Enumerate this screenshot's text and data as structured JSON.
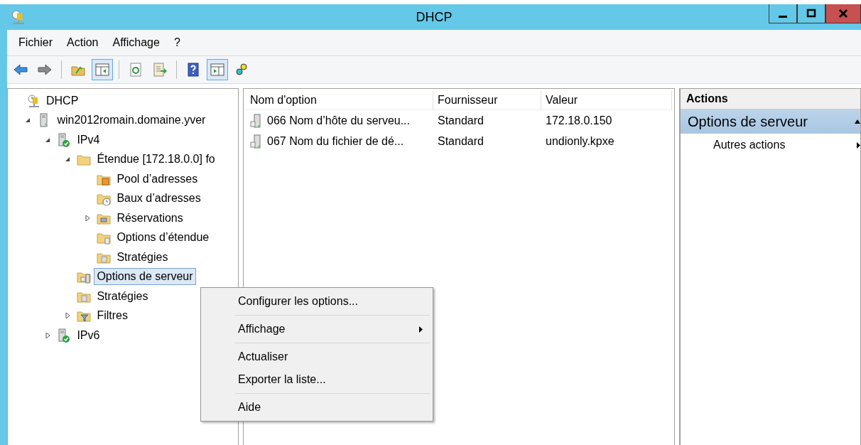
{
  "window": {
    "title": "DHCP"
  },
  "menu_bar": [
    "Fichier",
    "Action",
    "Affichage",
    "?"
  ],
  "toolbar": [
    {
      "kind": "back",
      "selected": false
    },
    {
      "kind": "forward",
      "selected": false
    },
    {
      "kind": "sep"
    },
    {
      "kind": "up",
      "selected": false
    },
    {
      "kind": "tree-pane",
      "selected": true
    },
    {
      "kind": "sep"
    },
    {
      "kind": "refresh",
      "selected": false
    },
    {
      "kind": "export",
      "selected": false
    },
    {
      "kind": "sep"
    },
    {
      "kind": "help",
      "selected": false
    },
    {
      "kind": "action-pane",
      "selected": true
    },
    {
      "kind": "gears",
      "selected": false
    }
  ],
  "tree": [
    {
      "label": "DHCP",
      "kind": "dhcp",
      "selected": false,
      "children": [
        {
          "label": "win2012romain.domaine.yver",
          "kind": "server",
          "expanded": true,
          "selected": false,
          "children": [
            {
              "label": "IPv4",
              "kind": "server-ok",
              "expanded": true,
              "selected": false,
              "children": [
                {
                  "label": "Étendue [172.18.0.0] fo",
                  "kind": "folder",
                  "expanded": true,
                  "selected": false,
                  "children": [
                    {
                      "label": "Pool d’adresses",
                      "kind": "pool",
                      "selected": false
                    },
                    {
                      "label": "Baux d’adresses",
                      "kind": "leases",
                      "selected": false
                    },
                    {
                      "label": "Réservations",
                      "kind": "reservations",
                      "expanded": false,
                      "selected": false
                    },
                    {
                      "label": "Options d’étendue",
                      "kind": "options",
                      "selected": false
                    },
                    {
                      "label": "Stratégies",
                      "kind": "policies",
                      "selected": false
                    }
                  ]
                },
                {
                  "label": "Options de serveur",
                  "kind": "server-options",
                  "selected": true
                },
                {
                  "label": "Stratégies",
                  "kind": "policies",
                  "selected": false
                },
                {
                  "label": "Filtres",
                  "kind": "filters",
                  "expanded": false,
                  "selected": false
                }
              ]
            },
            {
              "label": "IPv6",
              "kind": "server-ok",
              "expanded": false,
              "selected": false
            }
          ]
        }
      ]
    }
  ],
  "table": {
    "columns": [
      "Nom d'option",
      "Fournisseur",
      "Valeur"
    ],
    "rows": [
      [
        "066 Nom d’hôte du serveu...",
        "Standard",
        "172.18.0.150"
      ],
      [
        "067 Nom du fichier de dé...",
        "Standard",
        "undionly.kpxe"
      ]
    ]
  },
  "actions": {
    "title": "Actions",
    "section": "Options de serveur",
    "items": [
      "Autres actions"
    ]
  },
  "context_menu": [
    {
      "kind": "item",
      "label": "Configurer les options..."
    },
    {
      "kind": "separator"
    },
    {
      "kind": "submenu",
      "label": "Affichage"
    },
    {
      "kind": "separator"
    },
    {
      "kind": "item",
      "label": "Actualiser"
    },
    {
      "kind": "item",
      "label": "Exporter la liste..."
    },
    {
      "kind": "separator"
    },
    {
      "kind": "item",
      "label": "Aide"
    }
  ]
}
